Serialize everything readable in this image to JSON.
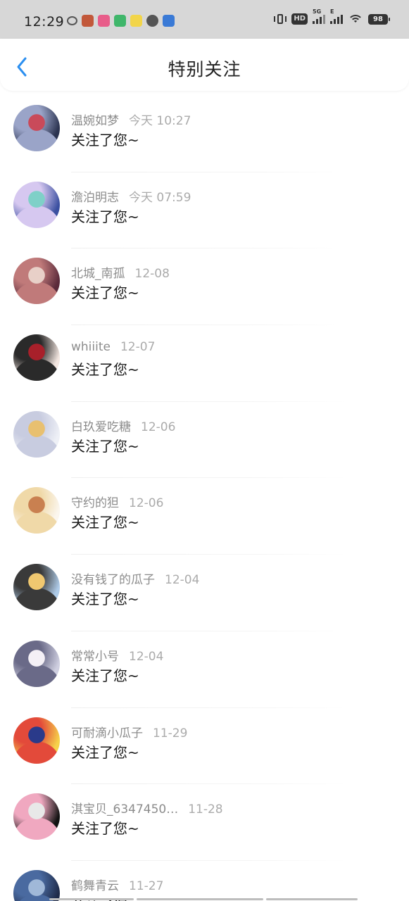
{
  "status_bar": {
    "time": "12:29",
    "hd_label": "HD",
    "net_label_1": "5G",
    "net_label_2": "E",
    "battery": "98"
  },
  "header": {
    "title": "特别关注",
    "back_icon": "chevron-left-icon"
  },
  "colors": {
    "accent": "#2b8ff0",
    "status_bar_bg": "#d7d7d7"
  },
  "list": [
    {
      "name": "温婉如梦",
      "time": "今天 10:27",
      "message": "关注了您~",
      "avatar_colors": [
        "#2b3350",
        "#9aa4c8",
        "#c94a5a"
      ]
    },
    {
      "name": "澹泊明志",
      "time": "今天 07:59",
      "message": "关注了您~",
      "avatar_colors": [
        "#3a4fa0",
        "#d6c8f0",
        "#7fd0c8"
      ]
    },
    {
      "name": "北城_南孤",
      "time": "12-08",
      "message": "关注了您~",
      "avatar_colors": [
        "#5a2a3a",
        "#c07a7a",
        "#e8d0c8"
      ]
    },
    {
      "name": "whiiite",
      "time": "12-07",
      "message": "关注了您~",
      "avatar_colors": [
        "#f3e6e0",
        "#2a2a2a",
        "#a8202a"
      ]
    },
    {
      "name": "白玖爱吃糖",
      "time": "12-06",
      "message": "关注了您~",
      "avatar_colors": [
        "#eef0f6",
        "#c8cce0",
        "#e8c070"
      ]
    },
    {
      "name": "守约的狚",
      "time": "12-06",
      "message": "关注了您~",
      "avatar_colors": [
        "#fbf6ee",
        "#f0d9a8",
        "#c98050"
      ]
    },
    {
      "name": "没有钱了的瓜子",
      "time": "12-04",
      "message": "关注了您~",
      "avatar_colors": [
        "#aecbe8",
        "#3a3a3a",
        "#f0c870"
      ]
    },
    {
      "name": "常常小号",
      "time": "12-04",
      "message": "关注了您~",
      "avatar_colors": [
        "#cfcfe0",
        "#6a6a88",
        "#f4f0f6"
      ]
    },
    {
      "name": "可耐滴小瓜子",
      "time": "11-29",
      "message": "关注了您~",
      "avatar_colors": [
        "#f6d24a",
        "#e34a3a",
        "#2a3a8a"
      ]
    },
    {
      "name": "淇宝贝_6347450…",
      "time": "11-28",
      "message": "关注了您~",
      "avatar_colors": [
        "#111111",
        "#f0a8c0",
        "#e8e8e8"
      ]
    },
    {
      "name": "鹤舞青云",
      "time": "11-27",
      "message": "关注了您~",
      "avatar_colors": [
        "#1e2a48",
        "#4a6aa0",
        "#a0b8d8"
      ]
    }
  ]
}
